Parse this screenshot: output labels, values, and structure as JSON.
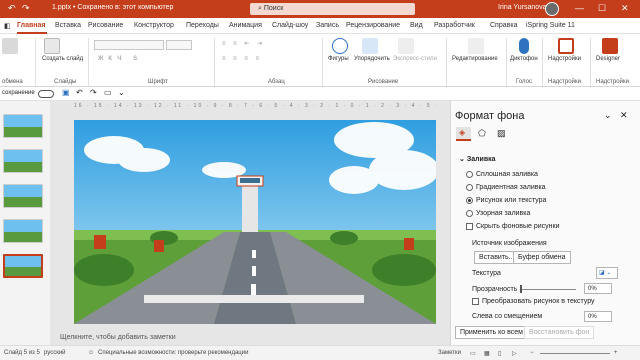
{
  "titlebar": {
    "doc_title": "1.pptx • Сохранено в: этот компьютер",
    "search_placeholder": "Поиск",
    "user_name": "Irina Yursanova",
    "colors": {
      "brand": "#c43e1c"
    }
  },
  "tabs": [
    "Главная",
    "Вставка",
    "Рисование",
    "Конструктор",
    "Переходы",
    "Анимация",
    "Слайд-шоу",
    "Запись",
    "Рецензирование",
    "Вид",
    "Разработчик",
    "Справка",
    "iSpring Suite 11"
  ],
  "ribbon": {
    "groups": {
      "clipboard": "обмена",
      "slides": "Слайды",
      "font": "Шрифт",
      "paragraph": "Абзац",
      "drawing": "Рисование",
      "voice": "Голос",
      "addins": "Надстройки"
    },
    "buttons": {
      "insert": "Вставить",
      "create_slide": "Создать слайд",
      "shapes": "Фигуры",
      "arrange": "Упорядочить",
      "express_styles": "Экспресс-стили",
      "editing": "Редактирование",
      "dictation": "Диктофон",
      "addins": "Надстройки",
      "designer": "Designer"
    }
  },
  "quickbar": {
    "autosave": "сохранение"
  },
  "editor": {
    "ruler_text": "16 · 15 · 14 · 13 · 12 · 11 · 10 · 9 · 8 · 7 · 6 · 5 · 4 · 3 · 2 · 1 · 0 · 1 · 2 · 3 · 4 · 5 · 6 · 7 · 8 · 9 · 10 · 11 · 12 · 13 · 14 · 15 · 16",
    "notes_placeholder": "Щелкните, чтобы добавить заметки"
  },
  "pane": {
    "title": "Формат фона",
    "section_fill": "Заливка",
    "fill_options": [
      {
        "label": "Сплошная заливка",
        "selected": false
      },
      {
        "label": "Градиентная заливка",
        "selected": false
      },
      {
        "label": "Рисунок или текстура",
        "selected": true
      },
      {
        "label": "Узорная заливка",
        "selected": false
      }
    ],
    "hide_bg": "Скрыть фоновые рисунки",
    "image_source": "Источник изображения",
    "insert_btn": "Вставить...",
    "clipboard_btn": "Буфер обмена",
    "texture": "Текстура",
    "transparency": "Прозрачность",
    "transparency_value": "0%",
    "tile_label": "Преобразовать рисунок в текстуру",
    "offset_left": "Слева со смещением",
    "offset_value": "0%",
    "apply_all": "Применить ко всем",
    "reset_bg": "Восстановить фон"
  },
  "status": {
    "slide_count": "Слайд 5 из 5",
    "language": "русский",
    "accessibility": "Специальные возможности: проверьте рекомендации",
    "notes": "Заметки"
  }
}
